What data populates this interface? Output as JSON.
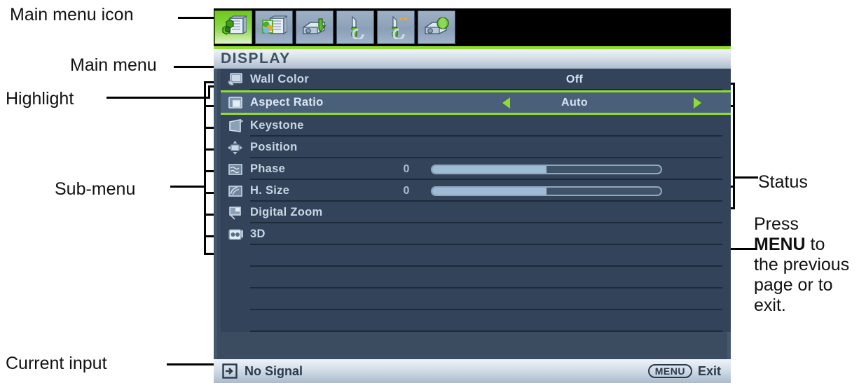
{
  "annotations": [
    {
      "id": "main-menu-icon",
      "text": "Main menu icon"
    },
    {
      "id": "main-menu",
      "text": "Main menu"
    },
    {
      "id": "highlight",
      "text": "Highlight"
    },
    {
      "id": "sub-menu",
      "text": "Sub-menu"
    },
    {
      "id": "current-input",
      "text": "Current input"
    },
    {
      "id": "status",
      "text": "Status"
    }
  ],
  "press_note": {
    "line1": "Press",
    "bold": "MENU",
    "after_bold": " to",
    "rest": "the previous page or to exit."
  },
  "osd": {
    "tabs": [
      {
        "name": "display-tab",
        "icon": "display-icon",
        "active": true
      },
      {
        "name": "picture-tab",
        "icon": "picture-color-icon",
        "active": false
      },
      {
        "name": "source-tab",
        "icon": "projector-icon",
        "active": false
      },
      {
        "name": "system-setup-basic-tab",
        "icon": "screwdriver-wrench-icon",
        "active": false
      },
      {
        "name": "system-setup-advanced-tab",
        "icon": "screwdriver-wrench-advanced-icon",
        "active": false
      },
      {
        "name": "information-tab",
        "icon": "projector-info-icon",
        "active": false
      }
    ],
    "title": "DISPLAY",
    "rows": [
      {
        "icon": "wall-color-icon",
        "label": "Wall Color",
        "value": "Off",
        "type": "value",
        "highlight": false
      },
      {
        "icon": "aspect-ratio-icon",
        "label": "Aspect Ratio",
        "value": "Auto",
        "type": "value",
        "highlight": true
      },
      {
        "icon": "keystone-icon",
        "label": "Keystone",
        "value": "",
        "type": "plain",
        "highlight": false
      },
      {
        "icon": "position-icon",
        "label": "Position",
        "value": "",
        "type": "plain",
        "highlight": false
      },
      {
        "icon": "phase-icon",
        "label": "Phase",
        "value": "0",
        "type": "slider",
        "slider_percent": 50,
        "highlight": false
      },
      {
        "icon": "h-size-icon",
        "label": "H. Size",
        "value": "0",
        "type": "slider",
        "slider_percent": 50,
        "highlight": false
      },
      {
        "icon": "digital-zoom-icon",
        "label": "Digital Zoom",
        "value": "",
        "type": "plain",
        "highlight": false
      },
      {
        "icon": "3d-icon",
        "label": "3D",
        "value": "",
        "type": "plain",
        "highlight": false
      },
      {
        "icon": "",
        "label": "",
        "value": "",
        "type": "empty",
        "highlight": false
      },
      {
        "icon": "",
        "label": "",
        "value": "",
        "type": "empty",
        "highlight": false
      },
      {
        "icon": "",
        "label": "",
        "value": "",
        "type": "empty",
        "highlight": false
      },
      {
        "icon": "",
        "label": "",
        "value": "",
        "type": "empty",
        "highlight": false
      }
    ],
    "status_bar": {
      "input_icon": "input-source-icon",
      "input_label": "No Signal",
      "menu_key": "MENU",
      "exit_label": "Exit"
    }
  },
  "colors": {
    "accent_green": "#8ede2c",
    "panel_blue": "#3b4c60",
    "row_light": "#455a72",
    "text_light": "#c9d6e4"
  }
}
